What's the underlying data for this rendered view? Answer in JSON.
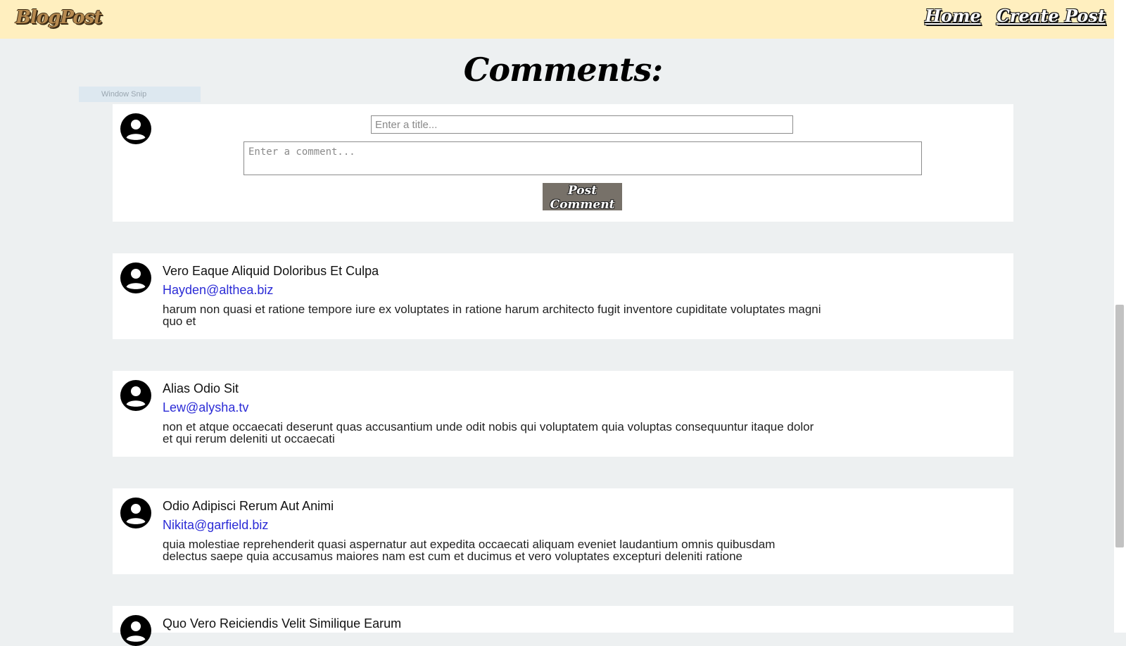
{
  "navbar": {
    "brand": "BlogPost",
    "links": [
      "Home",
      "Create Post"
    ]
  },
  "page": {
    "heading": "Comments:"
  },
  "overlay": {
    "label": "Window Snip"
  },
  "comment_form": {
    "title_placeholder": "Enter a title...",
    "comment_placeholder": "Enter a comment...",
    "submit_label": "Post Comment"
  },
  "comments": [
    {
      "title": "Vero Eaque Aliquid Doloribus Et Culpa",
      "email": "Hayden@althea.biz",
      "body": "harum non quasi et ratione tempore iure ex voluptates in ratione harum architecto fugit inventore cupiditate voluptates magni quo et"
    },
    {
      "title": "Alias Odio Sit",
      "email": "Lew@alysha.tv",
      "body": "non et atque occaecati deserunt quas accusantium unde odit nobis qui voluptatem quia voluptas consequuntur itaque dolor et qui rerum deleniti ut occaecati"
    },
    {
      "title": "Odio Adipisci Rerum Aut Animi",
      "email": "Nikita@garfield.biz",
      "body": "quia molestiae reprehenderit quasi aspernatur aut expedita occaecati aliquam eveniet laudantium omnis quibusdam delectus saepe quia accusamus maiores nam est cum et ducimus et vero voluptates excepturi deleniti ratione"
    },
    {
      "title": "Quo Vero Reiciendis Velit Similique Earum",
      "email": "",
      "body": ""
    }
  ],
  "icons": {
    "avatar": "user-circle-icon"
  },
  "colors": {
    "navbar_bg": "#ffefbf",
    "page_bg": "#edf0f1",
    "link": "#2b2bd6",
    "button_bg": "#777169"
  }
}
